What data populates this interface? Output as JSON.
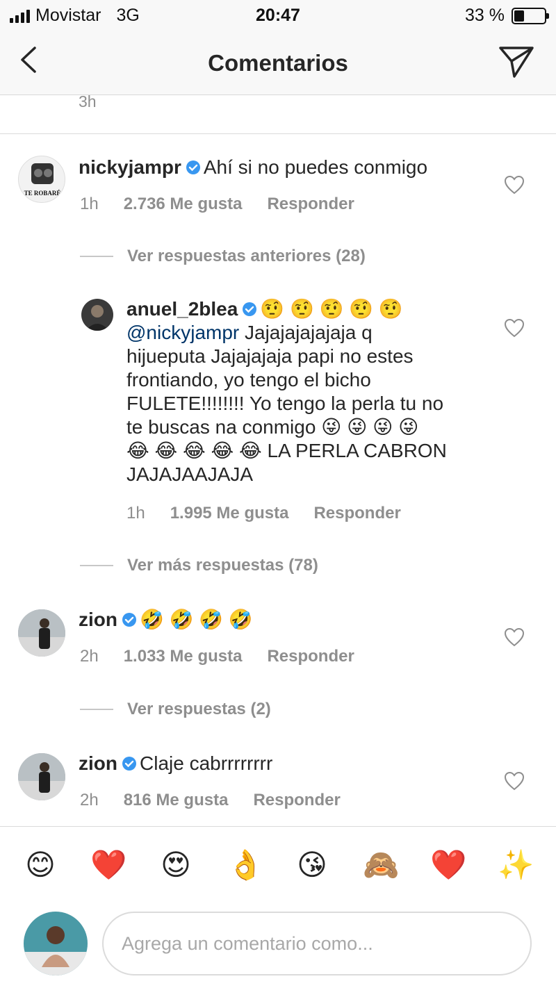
{
  "status_bar": {
    "carrier": "Movistar",
    "network": "3G",
    "time": "20:47",
    "battery": "33 %",
    "battery_level": 0.33
  },
  "header": {
    "title": "Comentarios"
  },
  "previous_comment_time": "3h",
  "comments": [
    {
      "user": "nickyjampr",
      "text": "Ahí si no puedes conmigo",
      "age": "1h",
      "likes": "2.736 Me gusta",
      "reply": "Responder"
    },
    {
      "user": "anuel_2blea",
      "mention": "@nickyjampr",
      "text_lines": [
        "🤨 🤨 🤨 🤨 🤨",
        "Jajajajajajaja q",
        "hijueputa Jajajajaja papi no estes",
        "frontiando, yo tengo el bicho",
        "FULETE!!!!!!!! Yo tengo la perla tu no",
        "te buscas na conmigo 😜 😜 😜 😜",
        "😂 😂 😂 😂 😂 LA PERLA CABRON",
        "JAJAJAAJAJA"
      ],
      "age": "1h",
      "likes": "1.995 Me gusta",
      "reply": "Responder"
    },
    {
      "user": "zion",
      "text": "🤣 🤣 🤣 🤣",
      "age": "2h",
      "likes": "1.033 Me gusta",
      "reply": "Responder"
    },
    {
      "user": "zion",
      "text": "Claje cabrrrrrrrr",
      "age": "2h",
      "likes": "816 Me gusta",
      "reply": "Responder"
    }
  ],
  "reply_links": [
    "Ver respuestas anteriores (28)",
    "Ver más respuestas (78)",
    "Ver respuestas (2)"
  ],
  "avatar_text": "TE ROBARÉ",
  "emoji_bar": [
    "😊",
    "❤️",
    "😍",
    "👌",
    "😘",
    "🙈",
    "❤️",
    "✨"
  ],
  "compose": {
    "placeholder": "Agrega un comentario como..."
  },
  "colors": {
    "verified": "#3897f0",
    "mention": "#003569",
    "secondary": "#8e8e8e"
  }
}
